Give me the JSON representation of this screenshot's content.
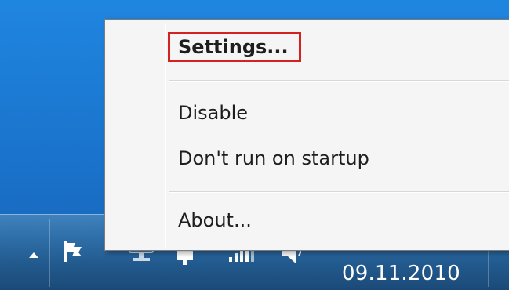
{
  "context_menu": {
    "items": [
      {
        "label": "Settings...",
        "bold": true
      },
      {
        "label": "Disable"
      },
      {
        "label": "Don't run on startup"
      },
      {
        "label": "About..."
      }
    ]
  },
  "taskbar": {
    "clock": "09.11.2010",
    "tray_icons": [
      "show-hidden-icons-arrow",
      "action-center-flag-icon",
      "network-computer-icon",
      "power-plug-icon",
      "signal-bars-icon",
      "speaker-volume-icon"
    ]
  },
  "colors": {
    "highlight": "#d42121",
    "menu_background": "#f5f5f5",
    "desktop": "#1f86e0"
  }
}
